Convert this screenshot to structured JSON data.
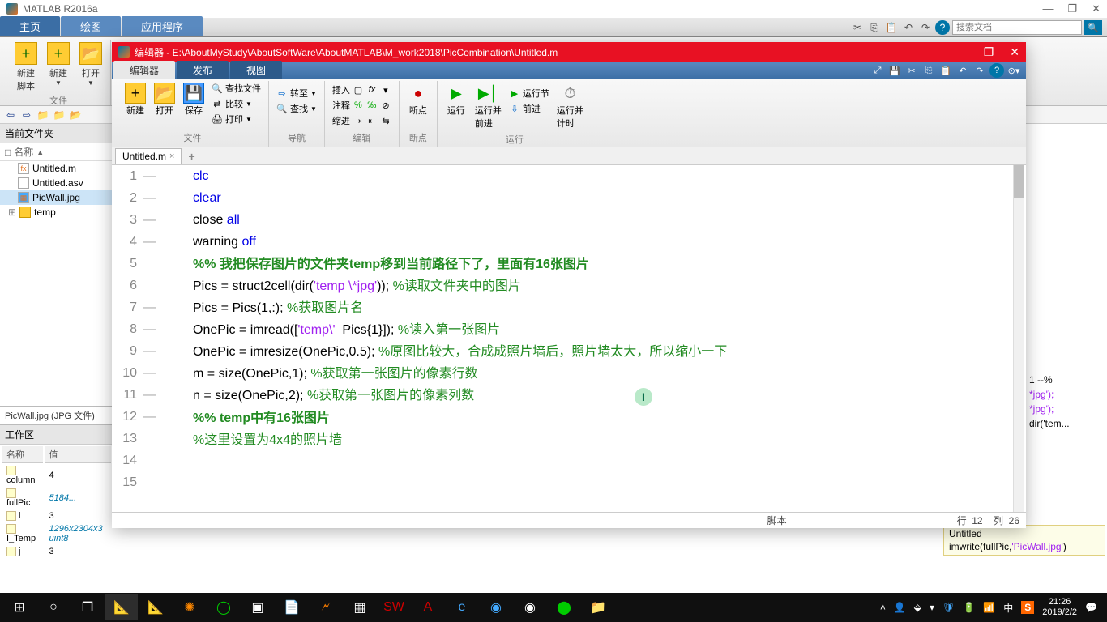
{
  "matlab": {
    "title": "MATLAB R2016a",
    "tabs": [
      "主页",
      "绘图",
      "应用程序"
    ],
    "search_placeholder": "搜索文档",
    "ribbon": {
      "new_script": "新建\n脚本",
      "new": "新建",
      "open": "打开",
      "group_file": "文件"
    }
  },
  "editor": {
    "title": "编辑器 - E:\\AboutMyStudy\\AboutSoftWare\\AboutMATLAB\\M_work2018\\PicCombination\\Untitled.m",
    "tabs": [
      "编辑器",
      "发布",
      "视图"
    ],
    "ribbon": {
      "new": "新建",
      "open": "打开",
      "save": "保存",
      "find_files": "查找文件",
      "compare": "比较",
      "print": "打印",
      "insert": "插入",
      "comment": "注释",
      "indent": "缩进",
      "goto": "转至",
      "find": "查找",
      "breakpoint": "断点",
      "run": "运行",
      "run_advance": "运行并\n前进",
      "run_section": "运行节",
      "advance": "前进",
      "run_time": "运行并\n计时",
      "grp_file": "文件",
      "grp_nav": "导航",
      "grp_edit": "编辑",
      "grp_bp": "断点",
      "grp_run": "运行"
    },
    "file_tab": "Untitled.m",
    "status_left": "",
    "status_mid": "脚本",
    "status_line": "行",
    "status_line_val": "12",
    "status_col": "列",
    "status_col_val": "26"
  },
  "code": {
    "lines": [
      {
        "n": 1,
        "dash": true,
        "tokens": [
          [
            "kw",
            "clc"
          ]
        ]
      },
      {
        "n": 2,
        "dash": true,
        "tokens": [
          [
            "kw",
            "clear"
          ]
        ]
      },
      {
        "n": 3,
        "dash": true,
        "tokens": [
          [
            "",
            "close "
          ],
          [
            "kw",
            "all"
          ]
        ]
      },
      {
        "n": 4,
        "dash": true,
        "tokens": [
          [
            "",
            "warning "
          ],
          [
            "kw",
            "off"
          ]
        ]
      },
      {
        "n": 5,
        "dash": false,
        "tokens": []
      },
      {
        "n": 6,
        "dash": false,
        "section": true,
        "tokens": [
          [
            "comsec",
            "%% 我把保存图片的文件夹temp移到当前路径下了，里面有16张图片"
          ]
        ]
      },
      {
        "n": 7,
        "dash": true,
        "tokens": [
          [
            "",
            "Pics = struct2cell(dir("
          ],
          [
            "str",
            "'temp \\*jpg'"
          ],
          [
            "",
            ")); "
          ],
          [
            "com",
            "%读取文件夹中的图片"
          ]
        ]
      },
      {
        "n": 8,
        "dash": true,
        "tokens": [
          [
            "",
            "Pics = Pics(1,:); "
          ],
          [
            "com",
            "%获取图片名"
          ]
        ]
      },
      {
        "n": 9,
        "dash": true,
        "tokens": [
          [
            "",
            "OnePic = imread(["
          ],
          [
            "str",
            "'temp\\'"
          ],
          [
            "",
            "  Pics{1}]); "
          ],
          [
            "com",
            "%读入第一张图片"
          ]
        ]
      },
      {
        "n": 10,
        "dash": true,
        "tokens": [
          [
            "",
            "OnePic = imresize(OnePic,0.5); "
          ],
          [
            "com",
            "%原图比较大，合成成照片墙后，照片墙太大，所以缩小一下"
          ]
        ]
      },
      {
        "n": 11,
        "dash": true,
        "tokens": [
          [
            "",
            "m = size(OnePic,1); "
          ],
          [
            "com",
            "%获取第一张图片的像素行数"
          ]
        ]
      },
      {
        "n": 12,
        "dash": true,
        "tokens": [
          [
            "",
            "n = size(OnePic,2); "
          ],
          [
            "com",
            "%获取第一张图片的像素列数"
          ]
        ]
      },
      {
        "n": 13,
        "dash": false,
        "tokens": []
      },
      {
        "n": 14,
        "dash": false,
        "section": true,
        "tokens": [
          [
            "comsec",
            "%% temp中有16张图片"
          ]
        ]
      },
      {
        "n": 15,
        "dash": false,
        "tokens": [
          [
            "com",
            "%这里设置为4x4的照片墙"
          ]
        ]
      }
    ]
  },
  "current_folder": {
    "title": "当前文件夹",
    "header": "名称",
    "items": [
      {
        "name": "Untitled.m",
        "type": "m"
      },
      {
        "name": "Untitled.asv",
        "type": "asv"
      },
      {
        "name": "PicWall.jpg",
        "type": "jpg",
        "selected": true
      },
      {
        "name": "temp",
        "type": "folder"
      }
    ],
    "detail": "PicWall.jpg  (JPG 文件)"
  },
  "workspace": {
    "title": "工作区",
    "cols": [
      "名称",
      "值"
    ],
    "rows": [
      {
        "name": "column",
        "val": "4"
      },
      {
        "name": "fullPic",
        "val": "5184..."
      },
      {
        "name": "i",
        "val": "3"
      },
      {
        "name": "I_Temp",
        "val": "1296x2304x3 uint8"
      },
      {
        "name": "j",
        "val": "3"
      }
    ]
  },
  "right_cmd_lines": [
    "1 --%",
    "*jpg');",
    "*jpg');",
    "dir('tem..."
  ],
  "history": {
    "line1": "Untitled",
    "line2_pre": "imwrite(fullPic,",
    "line2_str": "'PicWall.jpg'",
    "line2_post": ")"
  },
  "taskbar": {
    "time": "21:26",
    "date": "2019/2/2",
    "ime": "中"
  }
}
